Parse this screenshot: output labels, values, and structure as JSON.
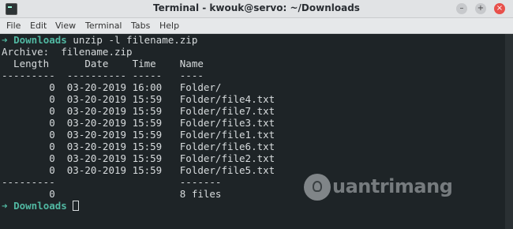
{
  "window": {
    "title": "Terminal - kwouk@servo: ~/Downloads",
    "minimize_label": "–",
    "maximize_label": "+",
    "close_label": "×"
  },
  "menu": [
    "File",
    "Edit",
    "View",
    "Terminal",
    "Tabs",
    "Help"
  ],
  "terminal": {
    "prompt_arrow": "➜",
    "prompt_dir": "Downloads",
    "command": " unzip -l filename.zip",
    "archive_line": "Archive:  filename.zip",
    "header_line": "  Length      Date    Time    Name",
    "separator_line": "---------  ---------- -----   ----",
    "rows": [
      "        0  03-20-2019 16:00   Folder/",
      "        0  03-20-2019 15:59   Folder/file4.txt",
      "        0  03-20-2019 15:59   Folder/file7.txt",
      "        0  03-20-2019 15:59   Folder/file3.txt",
      "        0  03-20-2019 15:59   Folder/file1.txt",
      "        0  03-20-2019 15:59   Folder/file6.txt",
      "        0  03-20-2019 15:59   Folder/file2.txt",
      "        0  03-20-2019 15:59   Folder/file5.txt"
    ],
    "footer_separator": "---------                     -------",
    "footer_total": "        0                     8 files"
  },
  "watermark": {
    "text": "uantrimang"
  },
  "colors": {
    "terminal_bg": "#1e2427",
    "prompt": "#51b8a2",
    "close_button": "#e8504b"
  }
}
